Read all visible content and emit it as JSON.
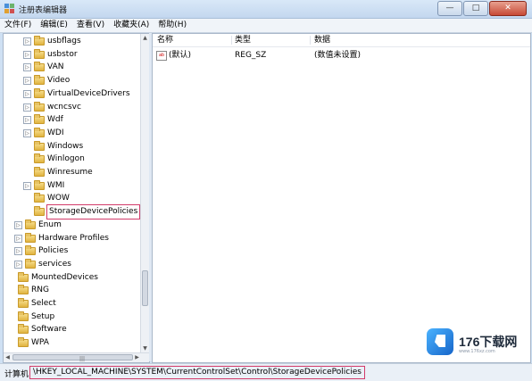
{
  "window": {
    "title": "注册表编辑器",
    "minimize_glyph": "—",
    "maximize_glyph": "□",
    "close_glyph": "✕"
  },
  "menu": [
    {
      "label": "文件(F)"
    },
    {
      "label": "编辑(E)"
    },
    {
      "label": "查看(V)"
    },
    {
      "label": "收藏夹(A)"
    },
    {
      "label": "帮助(H)"
    }
  ],
  "tree": {
    "items": [
      {
        "label": "usbflags",
        "level": 2,
        "expander": "▷"
      },
      {
        "label": "usbstor",
        "level": 2,
        "expander": "▷"
      },
      {
        "label": "VAN",
        "level": 2,
        "expander": "▷"
      },
      {
        "label": "Video",
        "level": 2,
        "expander": "▷"
      },
      {
        "label": "VirtualDeviceDrivers",
        "level": 2,
        "expander": "▷"
      },
      {
        "label": "wcncsvc",
        "level": 2,
        "expander": "▷"
      },
      {
        "label": "Wdf",
        "level": 2,
        "expander": "▷"
      },
      {
        "label": "WDI",
        "level": 2,
        "expander": "▷"
      },
      {
        "label": "Windows",
        "level": 2,
        "expander": ""
      },
      {
        "label": "Winlogon",
        "level": 2,
        "expander": ""
      },
      {
        "label": "Winresume",
        "level": 2,
        "expander": ""
      },
      {
        "label": "WMI",
        "level": 2,
        "expander": "▷"
      },
      {
        "label": "WOW",
        "level": 2,
        "expander": ""
      },
      {
        "label": "StorageDevicePolicies",
        "level": 2,
        "expander": "",
        "selected": true
      },
      {
        "label": "Enum",
        "level": 1,
        "expander": "▷"
      },
      {
        "label": "Hardware Profiles",
        "level": 1,
        "expander": "▷"
      },
      {
        "label": "Policies",
        "level": 1,
        "expander": "▷"
      },
      {
        "label": "services",
        "level": 1,
        "expander": "▷"
      },
      {
        "label": "MountedDevices",
        "level": 0,
        "expander": ""
      },
      {
        "label": "RNG",
        "level": 0,
        "expander": ""
      },
      {
        "label": "Select",
        "level": 0,
        "expander": ""
      },
      {
        "label": "Setup",
        "level": 0,
        "expander": ""
      },
      {
        "label": "Software",
        "level": 0,
        "expander": ""
      },
      {
        "label": "WPA",
        "level": 0,
        "expander": ""
      }
    ],
    "scroll_up": "▲",
    "scroll_down": "▼",
    "scroll_left": "◀",
    "scroll_right": "▶",
    "grip": "|||"
  },
  "list": {
    "columns": {
      "name": "名称",
      "type": "类型",
      "data": "数据"
    },
    "rows": [
      {
        "icon": "ab",
        "name": "(默认)",
        "type": "REG_SZ",
        "data": "(数值未设置)"
      }
    ]
  },
  "status": {
    "label": "计算机",
    "path": "\\HKEY_LOCAL_MACHINE\\SYSTEM\\CurrentControlSet\\Control\\StorageDevicePolicies"
  },
  "watermark": {
    "text": "176下载网",
    "sub": "www.176xz.com"
  }
}
